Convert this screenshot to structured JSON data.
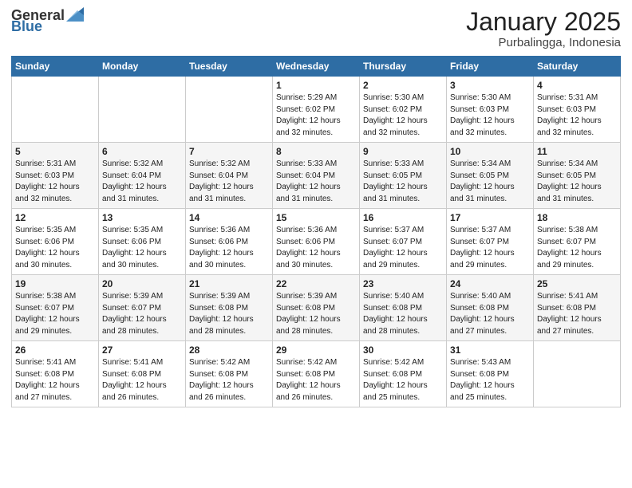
{
  "logo": {
    "text_general": "General",
    "text_blue": "Blue"
  },
  "title": {
    "month": "January 2025",
    "location": "Purbalingga, Indonesia"
  },
  "weekdays": [
    "Sunday",
    "Monday",
    "Tuesday",
    "Wednesday",
    "Thursday",
    "Friday",
    "Saturday"
  ],
  "weeks": [
    [
      {
        "day": null,
        "sunrise": null,
        "sunset": null,
        "daylight": null
      },
      {
        "day": null,
        "sunrise": null,
        "sunset": null,
        "daylight": null
      },
      {
        "day": null,
        "sunrise": null,
        "sunset": null,
        "daylight": null
      },
      {
        "day": "1",
        "sunrise": "Sunrise: 5:29 AM",
        "sunset": "Sunset: 6:02 PM",
        "daylight": "Daylight: 12 hours and 32 minutes."
      },
      {
        "day": "2",
        "sunrise": "Sunrise: 5:30 AM",
        "sunset": "Sunset: 6:02 PM",
        "daylight": "Daylight: 12 hours and 32 minutes."
      },
      {
        "day": "3",
        "sunrise": "Sunrise: 5:30 AM",
        "sunset": "Sunset: 6:03 PM",
        "daylight": "Daylight: 12 hours and 32 minutes."
      },
      {
        "day": "4",
        "sunrise": "Sunrise: 5:31 AM",
        "sunset": "Sunset: 6:03 PM",
        "daylight": "Daylight: 12 hours and 32 minutes."
      }
    ],
    [
      {
        "day": "5",
        "sunrise": "Sunrise: 5:31 AM",
        "sunset": "Sunset: 6:03 PM",
        "daylight": "Daylight: 12 hours and 32 minutes."
      },
      {
        "day": "6",
        "sunrise": "Sunrise: 5:32 AM",
        "sunset": "Sunset: 6:04 PM",
        "daylight": "Daylight: 12 hours and 31 minutes."
      },
      {
        "day": "7",
        "sunrise": "Sunrise: 5:32 AM",
        "sunset": "Sunset: 6:04 PM",
        "daylight": "Daylight: 12 hours and 31 minutes."
      },
      {
        "day": "8",
        "sunrise": "Sunrise: 5:33 AM",
        "sunset": "Sunset: 6:04 PM",
        "daylight": "Daylight: 12 hours and 31 minutes."
      },
      {
        "day": "9",
        "sunrise": "Sunrise: 5:33 AM",
        "sunset": "Sunset: 6:05 PM",
        "daylight": "Daylight: 12 hours and 31 minutes."
      },
      {
        "day": "10",
        "sunrise": "Sunrise: 5:34 AM",
        "sunset": "Sunset: 6:05 PM",
        "daylight": "Daylight: 12 hours and 31 minutes."
      },
      {
        "day": "11",
        "sunrise": "Sunrise: 5:34 AM",
        "sunset": "Sunset: 6:05 PM",
        "daylight": "Daylight: 12 hours and 31 minutes."
      }
    ],
    [
      {
        "day": "12",
        "sunrise": "Sunrise: 5:35 AM",
        "sunset": "Sunset: 6:06 PM",
        "daylight": "Daylight: 12 hours and 30 minutes."
      },
      {
        "day": "13",
        "sunrise": "Sunrise: 5:35 AM",
        "sunset": "Sunset: 6:06 PM",
        "daylight": "Daylight: 12 hours and 30 minutes."
      },
      {
        "day": "14",
        "sunrise": "Sunrise: 5:36 AM",
        "sunset": "Sunset: 6:06 PM",
        "daylight": "Daylight: 12 hours and 30 minutes."
      },
      {
        "day": "15",
        "sunrise": "Sunrise: 5:36 AM",
        "sunset": "Sunset: 6:06 PM",
        "daylight": "Daylight: 12 hours and 30 minutes."
      },
      {
        "day": "16",
        "sunrise": "Sunrise: 5:37 AM",
        "sunset": "Sunset: 6:07 PM",
        "daylight": "Daylight: 12 hours and 29 minutes."
      },
      {
        "day": "17",
        "sunrise": "Sunrise: 5:37 AM",
        "sunset": "Sunset: 6:07 PM",
        "daylight": "Daylight: 12 hours and 29 minutes."
      },
      {
        "day": "18",
        "sunrise": "Sunrise: 5:38 AM",
        "sunset": "Sunset: 6:07 PM",
        "daylight": "Daylight: 12 hours and 29 minutes."
      }
    ],
    [
      {
        "day": "19",
        "sunrise": "Sunrise: 5:38 AM",
        "sunset": "Sunset: 6:07 PM",
        "daylight": "Daylight: 12 hours and 29 minutes."
      },
      {
        "day": "20",
        "sunrise": "Sunrise: 5:39 AM",
        "sunset": "Sunset: 6:07 PM",
        "daylight": "Daylight: 12 hours and 28 minutes."
      },
      {
        "day": "21",
        "sunrise": "Sunrise: 5:39 AM",
        "sunset": "Sunset: 6:08 PM",
        "daylight": "Daylight: 12 hours and 28 minutes."
      },
      {
        "day": "22",
        "sunrise": "Sunrise: 5:39 AM",
        "sunset": "Sunset: 6:08 PM",
        "daylight": "Daylight: 12 hours and 28 minutes."
      },
      {
        "day": "23",
        "sunrise": "Sunrise: 5:40 AM",
        "sunset": "Sunset: 6:08 PM",
        "daylight": "Daylight: 12 hours and 28 minutes."
      },
      {
        "day": "24",
        "sunrise": "Sunrise: 5:40 AM",
        "sunset": "Sunset: 6:08 PM",
        "daylight": "Daylight: 12 hours and 27 minutes."
      },
      {
        "day": "25",
        "sunrise": "Sunrise: 5:41 AM",
        "sunset": "Sunset: 6:08 PM",
        "daylight": "Daylight: 12 hours and 27 minutes."
      }
    ],
    [
      {
        "day": "26",
        "sunrise": "Sunrise: 5:41 AM",
        "sunset": "Sunset: 6:08 PM",
        "daylight": "Daylight: 12 hours and 27 minutes."
      },
      {
        "day": "27",
        "sunrise": "Sunrise: 5:41 AM",
        "sunset": "Sunset: 6:08 PM",
        "daylight": "Daylight: 12 hours and 26 minutes."
      },
      {
        "day": "28",
        "sunrise": "Sunrise: 5:42 AM",
        "sunset": "Sunset: 6:08 PM",
        "daylight": "Daylight: 12 hours and 26 minutes."
      },
      {
        "day": "29",
        "sunrise": "Sunrise: 5:42 AM",
        "sunset": "Sunset: 6:08 PM",
        "daylight": "Daylight: 12 hours and 26 minutes."
      },
      {
        "day": "30",
        "sunrise": "Sunrise: 5:42 AM",
        "sunset": "Sunset: 6:08 PM",
        "daylight": "Daylight: 12 hours and 25 minutes."
      },
      {
        "day": "31",
        "sunrise": "Sunrise: 5:43 AM",
        "sunset": "Sunset: 6:08 PM",
        "daylight": "Daylight: 12 hours and 25 minutes."
      },
      {
        "day": null,
        "sunrise": null,
        "sunset": null,
        "daylight": null
      }
    ]
  ]
}
